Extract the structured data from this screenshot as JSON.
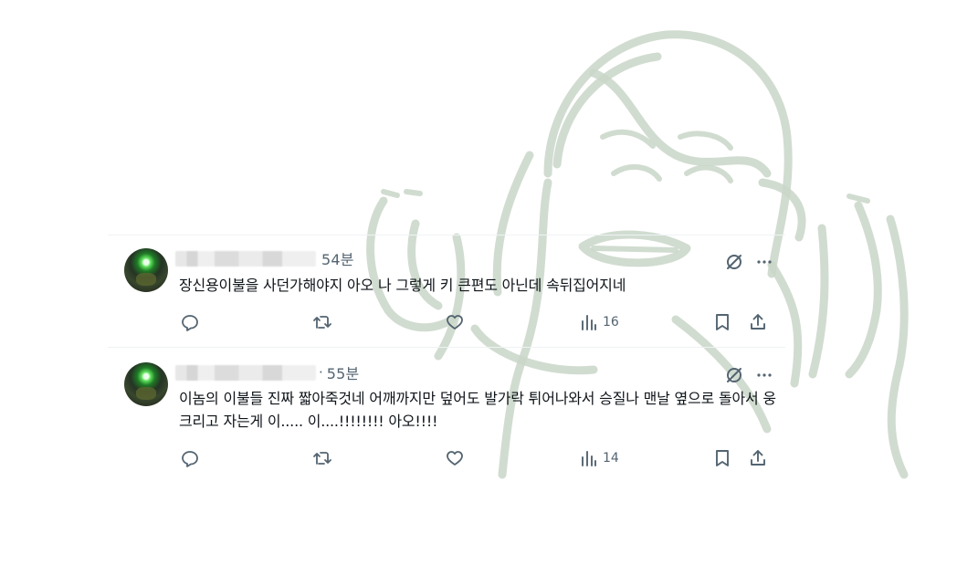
{
  "posts": [
    {
      "time": "54분",
      "text": "장신용이불을 사던가해야지 아오 나 그렇게 키 큰편도 아닌데 속뒤집어지네",
      "views": "16"
    },
    {
      "time": "55분",
      "text": "이놈의 이불들 진짜 짧아죽것네 어깨까지만 덮어도 발가락 튀어나와서 승질나 맨날 옆으로 돌아서 웅크리고 자는게 이..... 이....!!!!!!!! 아오!!!!",
      "views": "14"
    }
  ],
  "icons": {
    "avatar": "avatar-image",
    "grok": "grok-icon",
    "more": "more-icon",
    "reply": "reply-icon",
    "repost": "repost-icon",
    "like": "like-icon",
    "views": "views-icon",
    "bookmark": "bookmark-icon",
    "share": "share-icon"
  },
  "colors": {
    "text": "#0f1419",
    "secondary": "#536471",
    "divider": "#eff3f4",
    "doodle": "#c9d6c8"
  }
}
